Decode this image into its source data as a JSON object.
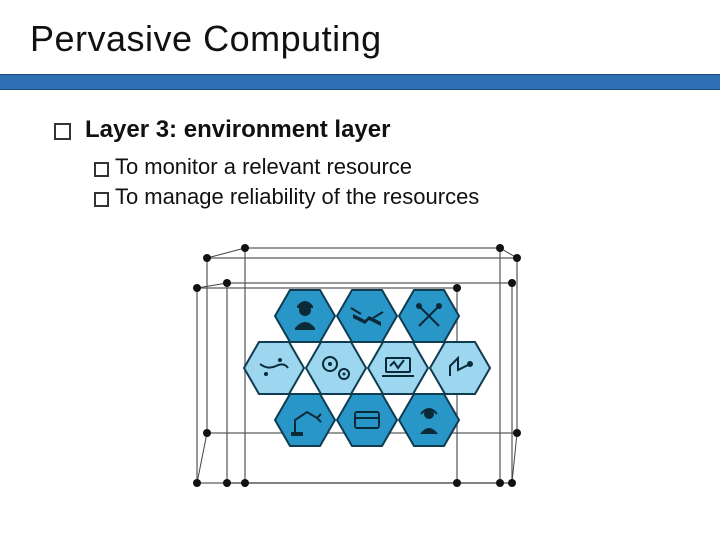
{
  "title": "Pervasive Computing",
  "heading": "Layer 3: environment layer",
  "sub_prefix": "To",
  "sub_items": [
    "monitor a relevant resource",
    "manage reliability of the resources"
  ],
  "figure": {
    "name": "environment-layer-hex-network",
    "hex_icons": [
      "worker",
      "handshake",
      "tools",
      "globe-map",
      "gears",
      "laptop-stats",
      "robot-arm",
      "person-headset"
    ]
  }
}
